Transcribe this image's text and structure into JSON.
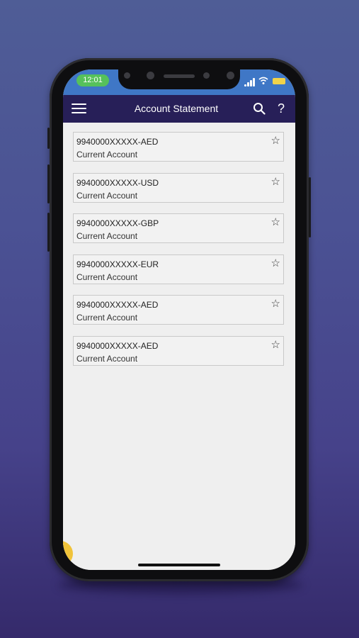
{
  "status_bar": {
    "time": "12:01"
  },
  "app_bar": {
    "title": "Account Statement",
    "menu_icon": "hamburger-menu-icon",
    "search_icon": "search-icon",
    "help_icon": "help-icon",
    "help_glyph": "?"
  },
  "accounts": [
    {
      "number": "9940000XXXXX-AED",
      "type": "Current Account"
    },
    {
      "number": "9940000XXXXX-USD",
      "type": "Current Account"
    },
    {
      "number": "9940000XXXXX-GBP",
      "type": "Current Account"
    },
    {
      "number": "9940000XXXXX-EUR",
      "type": "Current Account"
    },
    {
      "number": "9940000XXXXX-AED",
      "type": "Current Account"
    },
    {
      "number": "9940000XXXXX-AED",
      "type": "Current Account"
    }
  ],
  "star_glyph": "☆",
  "colors": {
    "status_bar": "#3f77c6",
    "app_bar": "#271f58",
    "time_pill": "#56c15b",
    "battery": "#f1d34a",
    "fab": "#f0c33a"
  }
}
